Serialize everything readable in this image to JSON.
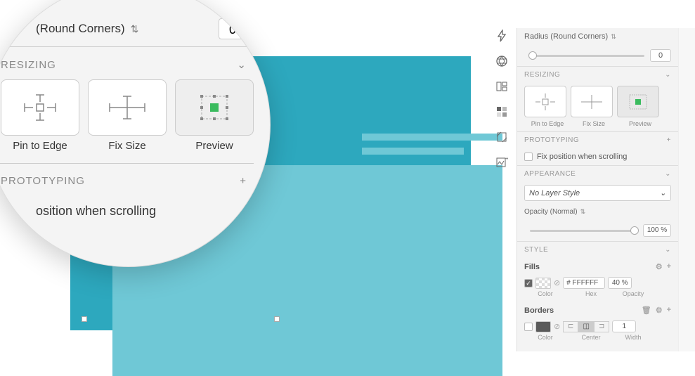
{
  "radius": {
    "label": "(Round Corners)",
    "value": "0"
  },
  "zoom": {
    "resizing_title": "RESIZING",
    "pin_label": "Pin to Edge",
    "fix_label": "Fix Size",
    "preview_label": "Preview",
    "prototyping_title": "PROTOTYPING",
    "fixpos_label": "osition when scrolling"
  },
  "inspector": {
    "radius_label": "Radius (Round Corners)",
    "radius_value": "0",
    "resizing_title": "RESIZING",
    "pin_label": "Pin to Edge",
    "fix_label": "Fix Size",
    "preview_label": "Preview",
    "prototyping_title": "PROTOTYPING",
    "fixpos_label": "Fix position when scrolling",
    "appearance_title": "APPEARANCE",
    "layer_style": "No Layer Style",
    "opacity_label": "Opacity (Normal)",
    "opacity_value": "100 %",
    "style_title": "STYLE",
    "fills_title": "Fills",
    "hex_value": "# FFFFFF",
    "fill_opacity": "40 %",
    "col_color": "Color",
    "col_hex": "Hex",
    "col_opacity": "Opacity",
    "borders_title": "Borders",
    "b_color": "Color",
    "b_center": "Center",
    "b_width": "Width",
    "border_width": "1"
  },
  "icons": {
    "chevron_sort": "⇅",
    "chevron_down": "⌄",
    "plus": "+",
    "gear": "⚙",
    "trash": "🗑"
  }
}
